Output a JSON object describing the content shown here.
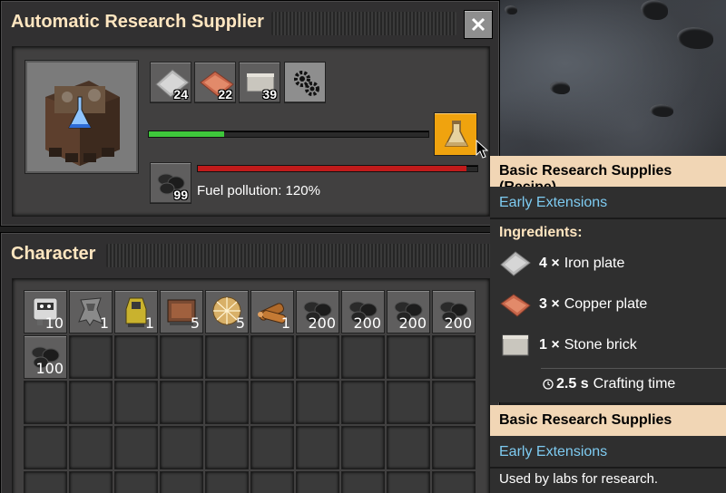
{
  "machine": {
    "title": "Automatic Research Supplier",
    "inputs": [
      {
        "icon": "iron-plate-icon",
        "count": "24"
      },
      {
        "icon": "copper-plate-icon",
        "count": "22"
      },
      {
        "icon": "stone-brick-icon",
        "count": "39"
      }
    ],
    "progress": 0.27,
    "fuel_count": "99",
    "fuel_pollution": "Fuel pollution: 120%",
    "fuel_level": 0.96,
    "colors": {
      "progress": "#3ec73b",
      "fuel": "#c01b1b",
      "recipe_button": "#f0a30e"
    }
  },
  "character": {
    "title": "Character",
    "slots": [
      {
        "icon": "robot-icon",
        "count": "10"
      },
      {
        "icon": "mech-armor-icon",
        "count": "1"
      },
      {
        "icon": "power-armor-icon",
        "count": "1"
      },
      {
        "icon": "crate-icon",
        "count": "5"
      },
      {
        "icon": "shield-orb-icon",
        "count": "5"
      },
      {
        "icon": "wood-icon",
        "count": "1"
      },
      {
        "icon": "coal-icon",
        "count": "200"
      },
      {
        "icon": "coal-icon",
        "count": "200"
      },
      {
        "icon": "coal-icon",
        "count": "200"
      },
      {
        "icon": "coal-icon",
        "count": "200"
      },
      {
        "icon": "coal-icon",
        "count": "100"
      }
    ]
  },
  "tooltip": {
    "recipe_title": "Basic Research Supplies (Recipe)",
    "recipe_source": "Early Extensions",
    "ingredients_label": "Ingredients:",
    "ingredients": [
      {
        "icon": "iron-plate-icon",
        "qty": "4 ×",
        "name": "Iron plate"
      },
      {
        "icon": "copper-plate-icon",
        "qty": "3 ×",
        "name": "Copper plate"
      },
      {
        "icon": "stone-brick-icon",
        "qty": "1 ×",
        "name": "Stone brick"
      }
    ],
    "crafting_time_value": "2.5 s",
    "crafting_time_label": "Crafting time",
    "item_title": "Basic Research Supplies",
    "item_source": "Early Extensions",
    "item_description": "Used by labs for research."
  }
}
